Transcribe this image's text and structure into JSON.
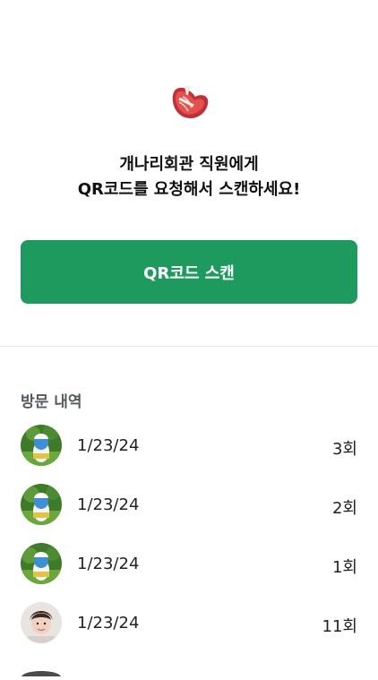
{
  "header": {
    "icon": "steak-icon",
    "line1": "개나리회관 직원에게",
    "line2": "QR코드를 요청해서 스캔하세요!"
  },
  "qr_button": {
    "label": "QR코드 스캔",
    "color": "#1f9a5f"
  },
  "visits": {
    "title": "방문 내역",
    "items": [
      {
        "date": "1/23/24",
        "count": "3회",
        "avatar": "smurf-avatar"
      },
      {
        "date": "1/23/24",
        "count": "2회",
        "avatar": "smurf-avatar"
      },
      {
        "date": "1/23/24",
        "count": "1회",
        "avatar": "smurf-avatar"
      },
      {
        "date": "1/23/24",
        "count": "11회",
        "avatar": "person-avatar"
      }
    ]
  }
}
